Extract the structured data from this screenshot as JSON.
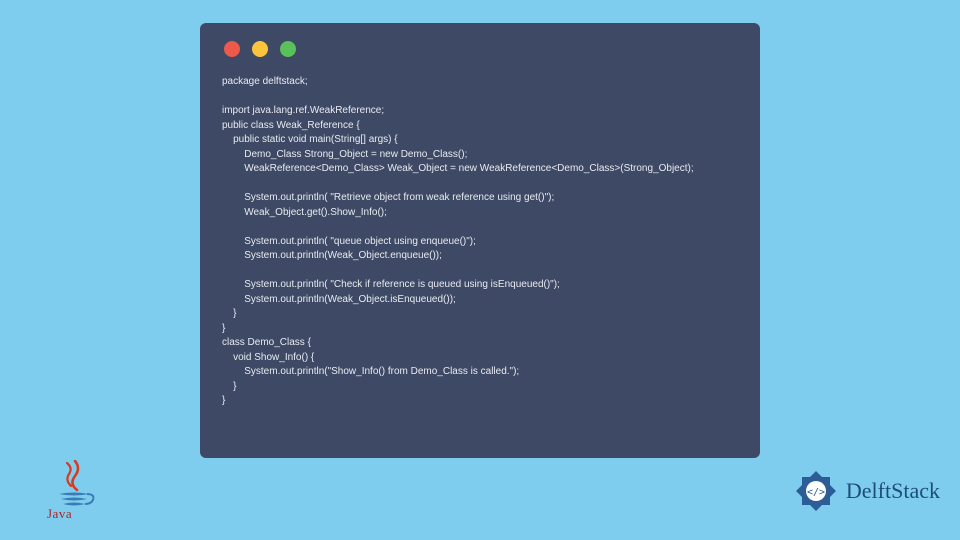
{
  "window": {
    "dots": {
      "red": "#ed594a",
      "yellow": "#fcc43c",
      "green": "#5ac05a"
    }
  },
  "code": "package delftstack;\n\nimport java.lang.ref.WeakReference;\npublic class Weak_Reference {\n    public static void main(String[] args) {\n        Demo_Class Strong_Object = new Demo_Class();\n        WeakReference<Demo_Class> Weak_Object = new WeakReference<Demo_Class>(Strong_Object);\n\n        System.out.println( \"Retrieve object from weak reference using get()\");\n        Weak_Object.get().Show_Info();\n\n        System.out.println( \"queue object using enqueue()\");\n        System.out.println(Weak_Object.enqueue());\n\n        System.out.println( \"Check if reference is queued using isEnqueued()\");\n        System.out.println(Weak_Object.isEnqueued());\n    }\n}\nclass Demo_Class {\n    void Show_Info() {\n        System.out.println(\"Show_Info() from Demo_Class is called.\");\n    }\n}",
  "logos": {
    "java": "Java",
    "delftstack": "DelftStack"
  }
}
